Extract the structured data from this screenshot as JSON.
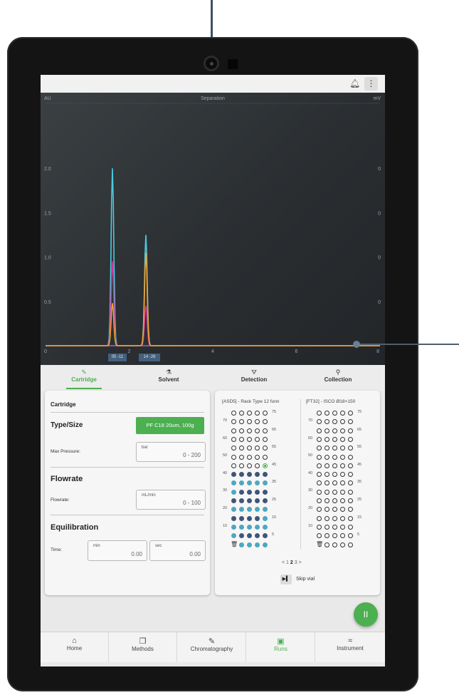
{
  "colors": {
    "accent": "#4caf50",
    "chart_bg": "#2e3336",
    "series_cyan": "#4cc9e0",
    "series_magenta": "#d0349a",
    "series_orange": "#f0a030",
    "baseline_violet": "#8b6bd8",
    "vial_dark": "#405578",
    "vial_teal": "#4ea7c2"
  },
  "topbar": {
    "bell_icon": "bell-icon",
    "menu_icon": "more-vert-icon"
  },
  "chart_data": {
    "type": "line",
    "title": "Separation",
    "ylabel_left": "AU",
    "ylabel_right": "mV",
    "xlim": [
      0,
      8
    ],
    "ylim": [
      0,
      2.5
    ],
    "x_ticks": [
      "0",
      "2",
      "4",
      "6",
      "8"
    ],
    "y_ticks_left": [
      "0.5",
      "1.0",
      "1.5",
      "2.0"
    ],
    "y_ticks_right": [
      "0",
      "0",
      "0",
      "0"
    ],
    "grid": true,
    "fraction_labels": [
      "05 -11",
      "14 -26"
    ],
    "series": [
      {
        "color": "#4cc9e0",
        "peaks": [
          [
            1.6,
            2.0
          ],
          [
            2.4,
            1.25
          ]
        ]
      },
      {
        "color": "#d0349a",
        "peaks": [
          [
            1.6,
            0.95
          ],
          [
            2.4,
            0.45
          ]
        ]
      },
      {
        "color": "#f0a030",
        "peaks": [
          [
            1.6,
            0.48
          ],
          [
            2.4,
            1.05
          ]
        ]
      }
    ]
  },
  "tabs": [
    {
      "label": "Cartridge",
      "icon": "pencil-icon",
      "active": true
    },
    {
      "label": "Solvent",
      "icon": "solvent-icon",
      "active": false
    },
    {
      "label": "Detection",
      "icon": "detection-icon",
      "active": false
    },
    {
      "label": "Collection",
      "icon": "test-tube-icon",
      "active": false
    }
  ],
  "left_panel": {
    "title": "Cartridge",
    "type_size_label": "Type/Size",
    "cartridge_button": "PF C18 20um, 100g",
    "max_pressure_label": "Max Pressure:",
    "max_pressure_unit": "bar",
    "max_pressure_value": "0 - 200",
    "flowrate_heading": "Flowrate",
    "flowrate_label": "Flowrate:",
    "flowrate_unit": "mL/min",
    "flowrate_value": "0 - 100",
    "equilibration_heading": "Equilibration",
    "time_label": "Time:",
    "min_unit": "min",
    "min_value": "0.00",
    "sec_unit": "sec",
    "sec_value": "0.00"
  },
  "right_panel": {
    "rack_left_title": "[ASD5] - Rack Type 12 funn",
    "rack_right_title": "[FT32] - ISCO Ø18×150",
    "row_numbers_right": [
      "75",
      "65",
      "55",
      "45",
      "35",
      "25",
      "15",
      "5"
    ],
    "row_numbers_left": [
      "70",
      "60",
      "50",
      "40",
      "30",
      "20",
      "10"
    ],
    "left_rows": [
      [
        "e",
        "e",
        "e",
        "e",
        "e"
      ],
      [
        "e",
        "e",
        "e",
        "e",
        "e"
      ],
      [
        "e",
        "e",
        "e",
        "e",
        "e"
      ],
      [
        "e",
        "e",
        "e",
        "e",
        "e"
      ],
      [
        "e",
        "e",
        "e",
        "e",
        "e"
      ],
      [
        "e",
        "e",
        "e",
        "e",
        "e"
      ],
      [
        "e",
        "e",
        "e",
        "e",
        "c"
      ],
      [
        "d",
        "d",
        "d",
        "d",
        "d"
      ],
      [
        "t",
        "t",
        "t",
        "t",
        "t"
      ],
      [
        "t",
        "d",
        "d",
        "d",
        "d"
      ],
      [
        "d",
        "d",
        "d",
        "d",
        "d"
      ],
      [
        "t",
        "t",
        "t",
        "t",
        "t"
      ],
      [
        "d",
        "d",
        "d",
        "d",
        "t"
      ],
      [
        "t",
        "t",
        "t",
        "t",
        "t"
      ],
      [
        "t",
        "d",
        "d",
        "d",
        "d"
      ],
      [
        "x",
        "t",
        "t",
        "t",
        "t"
      ]
    ],
    "right_rows": [
      [
        "e",
        "e",
        "e",
        "e",
        "e"
      ],
      [
        "e",
        "e",
        "e",
        "e",
        "e"
      ],
      [
        "e",
        "e",
        "e",
        "e",
        "e"
      ],
      [
        "e",
        "e",
        "e",
        "e",
        "e"
      ],
      [
        "e",
        "e",
        "e",
        "e",
        "e"
      ],
      [
        "e",
        "e",
        "e",
        "e",
        "e"
      ],
      [
        "e",
        "e",
        "e",
        "e",
        "e"
      ],
      [
        "e",
        "e",
        "e",
        "e",
        "e"
      ],
      [
        "e",
        "e",
        "e",
        "e",
        "e"
      ],
      [
        "e",
        "e",
        "e",
        "e",
        "e"
      ],
      [
        "e",
        "e",
        "e",
        "e",
        "e"
      ],
      [
        "e",
        "e",
        "e",
        "e",
        "e"
      ],
      [
        "e",
        "e",
        "e",
        "e",
        "e"
      ],
      [
        "e",
        "e",
        "e",
        "e",
        "e"
      ],
      [
        "e",
        "e",
        "e",
        "e",
        "e"
      ],
      [
        "x",
        "e",
        "e",
        "e",
        "e"
      ]
    ],
    "pager_prev": "<",
    "pager_pages": [
      "1",
      "2",
      "3"
    ],
    "pager_current": "2",
    "pager_next": ">",
    "skip_label": "Skip vial"
  },
  "fab": {
    "icon": "pause-icon",
    "symbol": "II"
  },
  "nav": [
    {
      "label": "Home",
      "icon": "home-icon",
      "glyph": "⌂"
    },
    {
      "label": "Methods",
      "icon": "methods-icon",
      "glyph": "❐"
    },
    {
      "label": "Chromatography",
      "icon": "pencil-icon",
      "glyph": "✎"
    },
    {
      "label": "Runs",
      "icon": "runs-icon",
      "glyph": "▣",
      "active": true
    },
    {
      "label": "Instrument",
      "icon": "instrument-icon",
      "glyph": "≈"
    }
  ]
}
